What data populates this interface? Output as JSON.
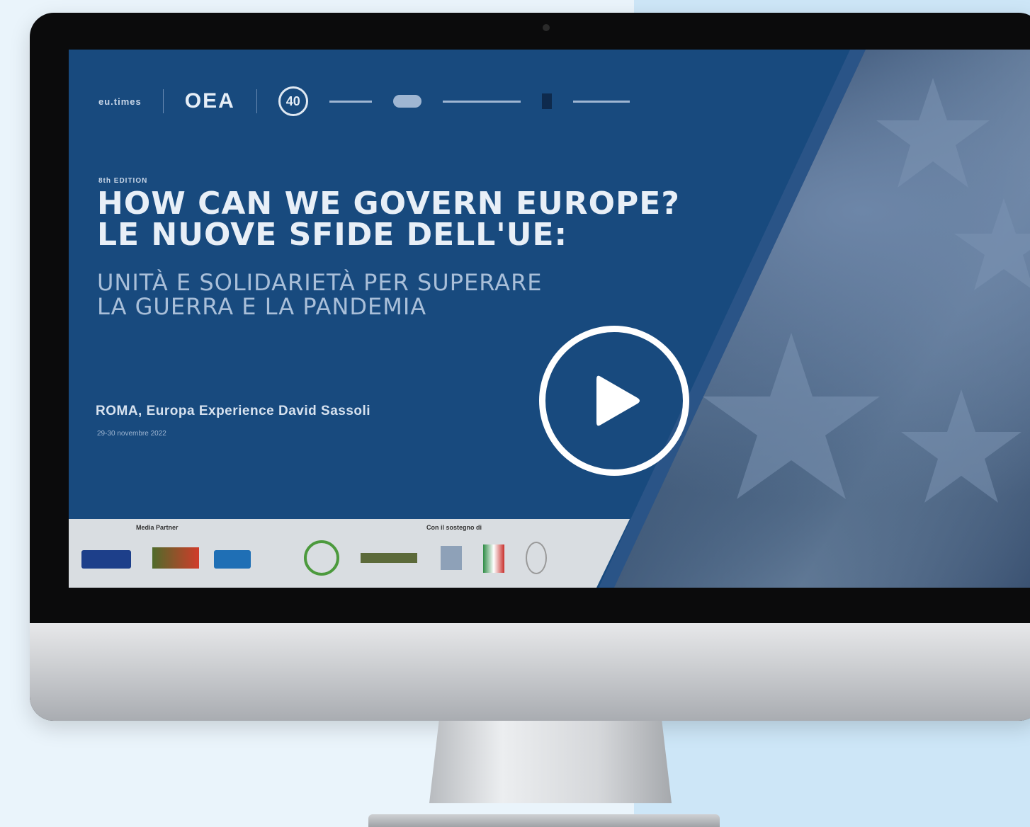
{
  "slide": {
    "top_logos": [
      "eu.times",
      "OEA",
      "40"
    ],
    "edition": "8th EDITION",
    "headline_line1": "HOW CAN WE GOVERN EUROPE?",
    "headline_line2": "LE NUOVE SFIDE DELL'UE:",
    "subhead_line1": "UNITÀ E SOLIDARIETÀ PER SUPERARE",
    "subhead_line2": "LA GUERRA E LA PANDEMIA",
    "location": "ROMA, Europa Experience David Sassoli",
    "dates": "29-30 novembre 2022",
    "media_partner_label": "Media Partner",
    "sponsor_label": "Con il sostegno di"
  },
  "video": {
    "play_icon": "play-circle-icon"
  },
  "colors": {
    "slide_blue": "#184a7e",
    "page_bg": "#eaf4fb",
    "page_bg_right": "#cde6f7"
  }
}
